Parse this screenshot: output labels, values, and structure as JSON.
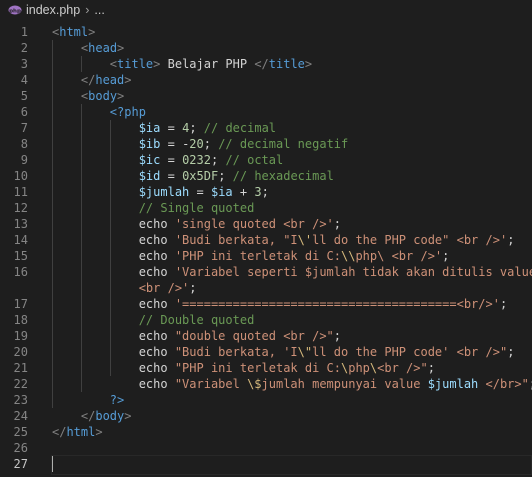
{
  "breadcrumb": {
    "file": "index.php",
    "symbol": "..."
  },
  "lines": [
    {
      "n": "1",
      "t": [
        [
          "pun",
          "<"
        ],
        [
          "tag",
          "html"
        ],
        [
          "pun",
          ">"
        ]
      ]
    },
    {
      "n": "2",
      "t": [
        [
          "txt",
          "    "
        ],
        [
          "pun",
          "<"
        ],
        [
          "tag",
          "head"
        ],
        [
          "pun",
          ">"
        ]
      ]
    },
    {
      "n": "3",
      "t": [
        [
          "txt",
          "        "
        ],
        [
          "pun",
          "<"
        ],
        [
          "tag",
          "title"
        ],
        [
          "pun",
          ">"
        ],
        [
          "txt",
          " Belajar PHP "
        ],
        [
          "pun",
          "</"
        ],
        [
          "tag",
          "title"
        ],
        [
          "pun",
          ">"
        ]
      ]
    },
    {
      "n": "4",
      "t": [
        [
          "txt",
          "    "
        ],
        [
          "pun",
          "</"
        ],
        [
          "tag",
          "head"
        ],
        [
          "pun",
          ">"
        ]
      ]
    },
    {
      "n": "5",
      "t": [
        [
          "txt",
          "    "
        ],
        [
          "pun",
          "<"
        ],
        [
          "tag",
          "body"
        ],
        [
          "pun",
          ">"
        ]
      ]
    },
    {
      "n": "6",
      "t": [
        [
          "txt",
          "        "
        ],
        [
          "tag",
          "<?php"
        ]
      ]
    },
    {
      "n": "7",
      "t": [
        [
          "txt",
          "            "
        ],
        [
          "var",
          "$ia"
        ],
        [
          "txt",
          " = "
        ],
        [
          "num",
          "4"
        ],
        [
          "txt",
          "; "
        ],
        [
          "com",
          "// decimal"
        ]
      ]
    },
    {
      "n": "8",
      "t": [
        [
          "txt",
          "            "
        ],
        [
          "var",
          "$ib"
        ],
        [
          "txt",
          " = -"
        ],
        [
          "num",
          "20"
        ],
        [
          "txt",
          "; "
        ],
        [
          "com",
          "// decimal negatif"
        ]
      ]
    },
    {
      "n": "9",
      "t": [
        [
          "txt",
          "            "
        ],
        [
          "var",
          "$ic"
        ],
        [
          "txt",
          " = "
        ],
        [
          "num",
          "0232"
        ],
        [
          "txt",
          "; "
        ],
        [
          "com",
          "// octal"
        ]
      ]
    },
    {
      "n": "10",
      "t": [
        [
          "txt",
          "            "
        ],
        [
          "var",
          "$id"
        ],
        [
          "txt",
          " = "
        ],
        [
          "num",
          "0x5DF"
        ],
        [
          "txt",
          "; "
        ],
        [
          "com",
          "// hexadecimal"
        ]
      ]
    },
    {
      "n": "11",
      "t": [
        [
          "txt",
          "            "
        ],
        [
          "var",
          "$jumlah"
        ],
        [
          "txt",
          " = "
        ],
        [
          "var",
          "$ia"
        ],
        [
          "txt",
          " + "
        ],
        [
          "num",
          "3"
        ],
        [
          "txt",
          ";"
        ]
      ]
    },
    {
      "n": "12",
      "t": [
        [
          "txt",
          "            "
        ],
        [
          "com",
          "// Single quoted"
        ]
      ]
    },
    {
      "n": "13",
      "t": [
        [
          "txt",
          "            echo "
        ],
        [
          "str",
          "'single quoted <br />'"
        ],
        [
          "txt",
          ";"
        ]
      ]
    },
    {
      "n": "14",
      "t": [
        [
          "txt",
          "            echo "
        ],
        [
          "str",
          "'Budi berkata, \"I"
        ],
        [
          "esc",
          "\\'"
        ],
        [
          "str",
          "ll do the PHP code\" <br />'"
        ],
        [
          "txt",
          ";"
        ]
      ]
    },
    {
      "n": "15",
      "t": [
        [
          "txt",
          "            echo "
        ],
        [
          "str",
          "'PHP ini terletak di C:"
        ],
        [
          "esc",
          "\\\\"
        ],
        [
          "str",
          "php\\ <br />'"
        ],
        [
          "txt",
          ";"
        ]
      ]
    },
    {
      "n": "16",
      "t": [
        [
          "txt",
          "            echo "
        ],
        [
          "str",
          "'Variabel seperti $jumlah tidak akan ditulis valuenya"
        ]
      ]
    },
    {
      "n": "",
      "t": [
        [
          "txt",
          "            "
        ],
        [
          "str",
          "<br />'"
        ],
        [
          "txt",
          ";"
        ]
      ]
    },
    {
      "n": "17",
      "t": [
        [
          "txt",
          "            echo "
        ],
        [
          "str",
          "'======================================<br/>'"
        ],
        [
          "txt",
          ";"
        ]
      ]
    },
    {
      "n": "18",
      "t": [
        [
          "txt",
          "            "
        ],
        [
          "com",
          "// Double quoted"
        ]
      ]
    },
    {
      "n": "19",
      "t": [
        [
          "txt",
          "            echo "
        ],
        [
          "str",
          "\"double quoted <br />\""
        ],
        [
          "txt",
          ";"
        ]
      ]
    },
    {
      "n": "20",
      "t": [
        [
          "txt",
          "            echo "
        ],
        [
          "str",
          "\"Budi berkata, 'I"
        ],
        [
          "esc",
          "\\\""
        ],
        [
          "str",
          "ll do the PHP code' <br />\""
        ],
        [
          "txt",
          ";"
        ]
      ]
    },
    {
      "n": "21",
      "t": [
        [
          "txt",
          "            echo "
        ],
        [
          "str",
          "\"PHP ini terletak di C:"
        ],
        [
          "esc",
          "\\"
        ],
        [
          "str",
          "php"
        ],
        [
          "esc",
          "\\"
        ],
        [
          "str",
          "<br />\""
        ],
        [
          "txt",
          ";"
        ]
      ]
    },
    {
      "n": "22",
      "t": [
        [
          "txt",
          "            echo "
        ],
        [
          "str",
          "\"Variabel "
        ],
        [
          "esc",
          "\\$"
        ],
        [
          "str",
          "jumlah mempunyai value "
        ],
        [
          "var",
          "$jumlah"
        ],
        [
          "str",
          " </br>\""
        ],
        [
          "txt",
          ";"
        ]
      ]
    },
    {
      "n": "23",
      "t": [
        [
          "txt",
          "        "
        ],
        [
          "tag",
          "?>"
        ]
      ]
    },
    {
      "n": "24",
      "t": [
        [
          "txt",
          "    "
        ],
        [
          "pun",
          "</"
        ],
        [
          "tag",
          "body"
        ],
        [
          "pun",
          ">"
        ]
      ]
    },
    {
      "n": "25",
      "t": [
        [
          "pun",
          "</"
        ],
        [
          "tag",
          "html"
        ],
        [
          "pun",
          ">"
        ]
      ]
    },
    {
      "n": "26",
      "t": []
    },
    {
      "n": "27",
      "t": [],
      "current": true
    }
  ],
  "colors": {
    "background": "#1e1e1e",
    "tag": "#569cd6",
    "variable": "#9cdcfe",
    "number": "#b5cea8",
    "comment": "#6a9955",
    "string": "#ce9178",
    "escape": "#d7ba7d"
  }
}
